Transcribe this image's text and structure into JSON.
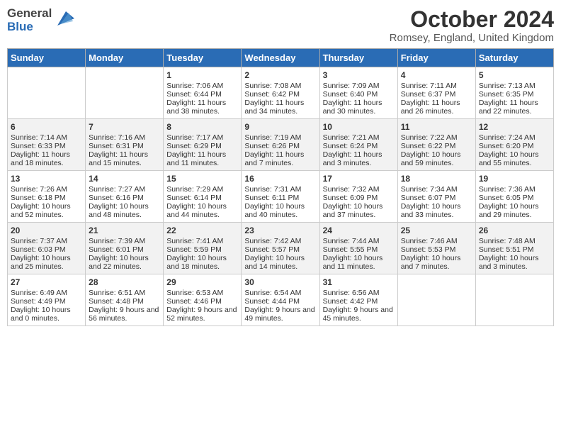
{
  "logo": {
    "general": "General",
    "blue": "Blue"
  },
  "header": {
    "month": "October 2024",
    "location": "Romsey, England, United Kingdom"
  },
  "days_of_week": [
    "Sunday",
    "Monday",
    "Tuesday",
    "Wednesday",
    "Thursday",
    "Friday",
    "Saturday"
  ],
  "weeks": [
    [
      {
        "day": "",
        "sunrise": "",
        "sunset": "",
        "daylight": ""
      },
      {
        "day": "",
        "sunrise": "",
        "sunset": "",
        "daylight": ""
      },
      {
        "day": "1",
        "sunrise": "Sunrise: 7:06 AM",
        "sunset": "Sunset: 6:44 PM",
        "daylight": "Daylight: 11 hours and 38 minutes."
      },
      {
        "day": "2",
        "sunrise": "Sunrise: 7:08 AM",
        "sunset": "Sunset: 6:42 PM",
        "daylight": "Daylight: 11 hours and 34 minutes."
      },
      {
        "day": "3",
        "sunrise": "Sunrise: 7:09 AM",
        "sunset": "Sunset: 6:40 PM",
        "daylight": "Daylight: 11 hours and 30 minutes."
      },
      {
        "day": "4",
        "sunrise": "Sunrise: 7:11 AM",
        "sunset": "Sunset: 6:37 PM",
        "daylight": "Daylight: 11 hours and 26 minutes."
      },
      {
        "day": "5",
        "sunrise": "Sunrise: 7:13 AM",
        "sunset": "Sunset: 6:35 PM",
        "daylight": "Daylight: 11 hours and 22 minutes."
      }
    ],
    [
      {
        "day": "6",
        "sunrise": "Sunrise: 7:14 AM",
        "sunset": "Sunset: 6:33 PM",
        "daylight": "Daylight: 11 hours and 18 minutes."
      },
      {
        "day": "7",
        "sunrise": "Sunrise: 7:16 AM",
        "sunset": "Sunset: 6:31 PM",
        "daylight": "Daylight: 11 hours and 15 minutes."
      },
      {
        "day": "8",
        "sunrise": "Sunrise: 7:17 AM",
        "sunset": "Sunset: 6:29 PM",
        "daylight": "Daylight: 11 hours and 11 minutes."
      },
      {
        "day": "9",
        "sunrise": "Sunrise: 7:19 AM",
        "sunset": "Sunset: 6:26 PM",
        "daylight": "Daylight: 11 hours and 7 minutes."
      },
      {
        "day": "10",
        "sunrise": "Sunrise: 7:21 AM",
        "sunset": "Sunset: 6:24 PM",
        "daylight": "Daylight: 11 hours and 3 minutes."
      },
      {
        "day": "11",
        "sunrise": "Sunrise: 7:22 AM",
        "sunset": "Sunset: 6:22 PM",
        "daylight": "Daylight: 10 hours and 59 minutes."
      },
      {
        "day": "12",
        "sunrise": "Sunrise: 7:24 AM",
        "sunset": "Sunset: 6:20 PM",
        "daylight": "Daylight: 10 hours and 55 minutes."
      }
    ],
    [
      {
        "day": "13",
        "sunrise": "Sunrise: 7:26 AM",
        "sunset": "Sunset: 6:18 PM",
        "daylight": "Daylight: 10 hours and 52 minutes."
      },
      {
        "day": "14",
        "sunrise": "Sunrise: 7:27 AM",
        "sunset": "Sunset: 6:16 PM",
        "daylight": "Daylight: 10 hours and 48 minutes."
      },
      {
        "day": "15",
        "sunrise": "Sunrise: 7:29 AM",
        "sunset": "Sunset: 6:14 PM",
        "daylight": "Daylight: 10 hours and 44 minutes."
      },
      {
        "day": "16",
        "sunrise": "Sunrise: 7:31 AM",
        "sunset": "Sunset: 6:11 PM",
        "daylight": "Daylight: 10 hours and 40 minutes."
      },
      {
        "day": "17",
        "sunrise": "Sunrise: 7:32 AM",
        "sunset": "Sunset: 6:09 PM",
        "daylight": "Daylight: 10 hours and 37 minutes."
      },
      {
        "day": "18",
        "sunrise": "Sunrise: 7:34 AM",
        "sunset": "Sunset: 6:07 PM",
        "daylight": "Daylight: 10 hours and 33 minutes."
      },
      {
        "day": "19",
        "sunrise": "Sunrise: 7:36 AM",
        "sunset": "Sunset: 6:05 PM",
        "daylight": "Daylight: 10 hours and 29 minutes."
      }
    ],
    [
      {
        "day": "20",
        "sunrise": "Sunrise: 7:37 AM",
        "sunset": "Sunset: 6:03 PM",
        "daylight": "Daylight: 10 hours and 25 minutes."
      },
      {
        "day": "21",
        "sunrise": "Sunrise: 7:39 AM",
        "sunset": "Sunset: 6:01 PM",
        "daylight": "Daylight: 10 hours and 22 minutes."
      },
      {
        "day": "22",
        "sunrise": "Sunrise: 7:41 AM",
        "sunset": "Sunset: 5:59 PM",
        "daylight": "Daylight: 10 hours and 18 minutes."
      },
      {
        "day": "23",
        "sunrise": "Sunrise: 7:42 AM",
        "sunset": "Sunset: 5:57 PM",
        "daylight": "Daylight: 10 hours and 14 minutes."
      },
      {
        "day": "24",
        "sunrise": "Sunrise: 7:44 AM",
        "sunset": "Sunset: 5:55 PM",
        "daylight": "Daylight: 10 hours and 11 minutes."
      },
      {
        "day": "25",
        "sunrise": "Sunrise: 7:46 AM",
        "sunset": "Sunset: 5:53 PM",
        "daylight": "Daylight: 10 hours and 7 minutes."
      },
      {
        "day": "26",
        "sunrise": "Sunrise: 7:48 AM",
        "sunset": "Sunset: 5:51 PM",
        "daylight": "Daylight: 10 hours and 3 minutes."
      }
    ],
    [
      {
        "day": "27",
        "sunrise": "Sunrise: 6:49 AM",
        "sunset": "Sunset: 4:49 PM",
        "daylight": "Daylight: 10 hours and 0 minutes."
      },
      {
        "day": "28",
        "sunrise": "Sunrise: 6:51 AM",
        "sunset": "Sunset: 4:48 PM",
        "daylight": "Daylight: 9 hours and 56 minutes."
      },
      {
        "day": "29",
        "sunrise": "Sunrise: 6:53 AM",
        "sunset": "Sunset: 4:46 PM",
        "daylight": "Daylight: 9 hours and 52 minutes."
      },
      {
        "day": "30",
        "sunrise": "Sunrise: 6:54 AM",
        "sunset": "Sunset: 4:44 PM",
        "daylight": "Daylight: 9 hours and 49 minutes."
      },
      {
        "day": "31",
        "sunrise": "Sunrise: 6:56 AM",
        "sunset": "Sunset: 4:42 PM",
        "daylight": "Daylight: 9 hours and 45 minutes."
      },
      {
        "day": "",
        "sunrise": "",
        "sunset": "",
        "daylight": ""
      },
      {
        "day": "",
        "sunrise": "",
        "sunset": "",
        "daylight": ""
      }
    ]
  ]
}
